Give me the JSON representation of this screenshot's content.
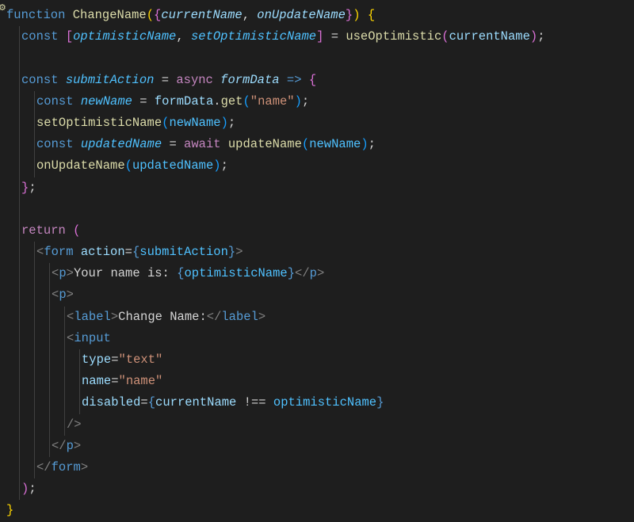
{
  "editor": {
    "language": "javascript-react",
    "theme": "dark-plus",
    "font": "Menlo",
    "lines": [
      {
        "n": 1,
        "indent": 0,
        "tokens": [
          {
            "t": "function ",
            "c": "kw"
          },
          {
            "t": "ChangeName",
            "c": "fn"
          },
          {
            "t": "(",
            "c": "brc1"
          },
          {
            "t": "{",
            "c": "brc2"
          },
          {
            "t": "currentName",
            "c": "var"
          },
          {
            "t": ", ",
            "c": "punc"
          },
          {
            "t": "onUpdateName",
            "c": "var"
          },
          {
            "t": "}",
            "c": "brc2"
          },
          {
            "t": ")",
            "c": "brc1"
          },
          {
            "t": " ",
            "c": "punc"
          },
          {
            "t": "{",
            "c": "brc1"
          }
        ]
      },
      {
        "n": 2,
        "indent": 1,
        "g": [
          1
        ],
        "tokens": [
          {
            "t": "const ",
            "c": "str"
          },
          {
            "t": "[",
            "c": "brc2"
          },
          {
            "t": "optimisticName",
            "c": "cnst"
          },
          {
            "t": ", ",
            "c": "punc"
          },
          {
            "t": "setOptimisticName",
            "c": "cnst"
          },
          {
            "t": "]",
            "c": "brc2"
          },
          {
            "t": " = ",
            "c": "op"
          },
          {
            "t": "useOptimistic",
            "c": "fn"
          },
          {
            "t": "(",
            "c": "brc2"
          },
          {
            "t": "currentName",
            "c": "varn"
          },
          {
            "t": ")",
            "c": "brc2"
          },
          {
            "t": ";",
            "c": "punc"
          }
        ]
      },
      {
        "n": 3,
        "indent": 0,
        "g": [
          1
        ],
        "tokens": []
      },
      {
        "n": 4,
        "indent": 1,
        "g": [
          1
        ],
        "tokens": [
          {
            "t": "const ",
            "c": "str"
          },
          {
            "t": "submitAction",
            "c": "cnst"
          },
          {
            "t": " = ",
            "c": "op"
          },
          {
            "t": "async ",
            "c": "ctrl"
          },
          {
            "t": "formData",
            "c": "var"
          },
          {
            "t": " ",
            "c": "punc"
          },
          {
            "t": "=>",
            "c": "str"
          },
          {
            "t": " ",
            "c": "punc"
          },
          {
            "t": "{",
            "c": "brc2"
          }
        ]
      },
      {
        "n": 5,
        "indent": 2,
        "g": [
          1,
          2
        ],
        "tokens": [
          {
            "t": "const ",
            "c": "str"
          },
          {
            "t": "newName",
            "c": "cnst"
          },
          {
            "t": " = ",
            "c": "op"
          },
          {
            "t": "formData",
            "c": "varn"
          },
          {
            "t": ".",
            "c": "punc"
          },
          {
            "t": "get",
            "c": "fn"
          },
          {
            "t": "(",
            "c": "brc3"
          },
          {
            "t": "\"name\"",
            "c": "strl"
          },
          {
            "t": ")",
            "c": "brc3"
          },
          {
            "t": ";",
            "c": "punc"
          }
        ]
      },
      {
        "n": 6,
        "indent": 2,
        "g": [
          1,
          2
        ],
        "tokens": [
          {
            "t": "setOptimisticName",
            "c": "fn"
          },
          {
            "t": "(",
            "c": "brc3"
          },
          {
            "t": "newName",
            "c": "cnstn"
          },
          {
            "t": ")",
            "c": "brc3"
          },
          {
            "t": ";",
            "c": "punc"
          }
        ]
      },
      {
        "n": 7,
        "indent": 2,
        "g": [
          1,
          2
        ],
        "tokens": [
          {
            "t": "const ",
            "c": "str"
          },
          {
            "t": "updatedName",
            "c": "cnst"
          },
          {
            "t": " = ",
            "c": "op"
          },
          {
            "t": "await ",
            "c": "ctrl"
          },
          {
            "t": "updateName",
            "c": "fn"
          },
          {
            "t": "(",
            "c": "brc3"
          },
          {
            "t": "newName",
            "c": "cnstn"
          },
          {
            "t": ")",
            "c": "brc3"
          },
          {
            "t": ";",
            "c": "punc"
          }
        ]
      },
      {
        "n": 8,
        "indent": 2,
        "g": [
          1,
          2
        ],
        "tokens": [
          {
            "t": "onUpdateName",
            "c": "fn"
          },
          {
            "t": "(",
            "c": "brc3"
          },
          {
            "t": "updatedName",
            "c": "cnstn"
          },
          {
            "t": ")",
            "c": "brc3"
          },
          {
            "t": ";",
            "c": "punc"
          }
        ]
      },
      {
        "n": 9,
        "indent": 1,
        "g": [
          1
        ],
        "tokens": [
          {
            "t": "}",
            "c": "brc2"
          },
          {
            "t": ";",
            "c": "punc"
          }
        ]
      },
      {
        "n": 10,
        "indent": 0,
        "g": [
          1
        ],
        "tokens": []
      },
      {
        "n": 11,
        "indent": 1,
        "g": [
          1
        ],
        "tokens": [
          {
            "t": "return ",
            "c": "ctrl"
          },
          {
            "t": "(",
            "c": "brc2"
          }
        ]
      },
      {
        "n": 12,
        "indent": 2,
        "g": [
          1,
          2
        ],
        "tokens": [
          {
            "t": "<",
            "c": "tag"
          },
          {
            "t": "form",
            "c": "tagn"
          },
          {
            "t": " ",
            "c": "punc"
          },
          {
            "t": "action",
            "c": "attr"
          },
          {
            "t": "=",
            "c": "op"
          },
          {
            "t": "{",
            "c": "str"
          },
          {
            "t": "submitAction",
            "c": "cnstn"
          },
          {
            "t": "}",
            "c": "str"
          },
          {
            "t": ">",
            "c": "tag"
          }
        ]
      },
      {
        "n": 13,
        "indent": 3,
        "g": [
          1,
          2,
          3
        ],
        "tokens": [
          {
            "t": "<",
            "c": "tag"
          },
          {
            "t": "p",
            "c": "tagn"
          },
          {
            "t": ">",
            "c": "tag"
          },
          {
            "t": "Your name is: ",
            "c": "txt"
          },
          {
            "t": "{",
            "c": "str"
          },
          {
            "t": "optimisticName",
            "c": "cnstn"
          },
          {
            "t": "}",
            "c": "str"
          },
          {
            "t": "</",
            "c": "tag"
          },
          {
            "t": "p",
            "c": "tagn"
          },
          {
            "t": ">",
            "c": "tag"
          }
        ]
      },
      {
        "n": 14,
        "indent": 3,
        "g": [
          1,
          2,
          3
        ],
        "tokens": [
          {
            "t": "<",
            "c": "tag"
          },
          {
            "t": "p",
            "c": "tagn"
          },
          {
            "t": ">",
            "c": "tag"
          }
        ]
      },
      {
        "n": 15,
        "indent": 4,
        "g": [
          1,
          2,
          3,
          4
        ],
        "tokens": [
          {
            "t": "<",
            "c": "tag"
          },
          {
            "t": "label",
            "c": "tagn"
          },
          {
            "t": ">",
            "c": "tag"
          },
          {
            "t": "Change Name:",
            "c": "txt"
          },
          {
            "t": "</",
            "c": "tag"
          },
          {
            "t": "label",
            "c": "tagn"
          },
          {
            "t": ">",
            "c": "tag"
          }
        ]
      },
      {
        "n": 16,
        "indent": 4,
        "g": [
          1,
          2,
          3,
          4
        ],
        "tokens": [
          {
            "t": "<",
            "c": "tag"
          },
          {
            "t": "input",
            "c": "tagn"
          }
        ]
      },
      {
        "n": 17,
        "indent": 5,
        "g": [
          1,
          2,
          3,
          4,
          5
        ],
        "tokens": [
          {
            "t": "type",
            "c": "attr"
          },
          {
            "t": "=",
            "c": "op"
          },
          {
            "t": "\"text\"",
            "c": "strl"
          }
        ]
      },
      {
        "n": 18,
        "indent": 5,
        "g": [
          1,
          2,
          3,
          4,
          5
        ],
        "tokens": [
          {
            "t": "name",
            "c": "attr"
          },
          {
            "t": "=",
            "c": "op"
          },
          {
            "t": "\"name\"",
            "c": "strl"
          }
        ]
      },
      {
        "n": 19,
        "indent": 5,
        "g": [
          1,
          2,
          3,
          4,
          5
        ],
        "tokens": [
          {
            "t": "disabled",
            "c": "attr"
          },
          {
            "t": "=",
            "c": "op"
          },
          {
            "t": "{",
            "c": "str"
          },
          {
            "t": "currentName",
            "c": "varn"
          },
          {
            "t": " !== ",
            "c": "op"
          },
          {
            "t": "optimisticName",
            "c": "cnstn"
          },
          {
            "t": "}",
            "c": "str"
          }
        ]
      },
      {
        "n": 20,
        "indent": 4,
        "g": [
          1,
          2,
          3,
          4
        ],
        "tokens": [
          {
            "t": "/>",
            "c": "tag"
          }
        ]
      },
      {
        "n": 21,
        "indent": 3,
        "g": [
          1,
          2,
          3
        ],
        "tokens": [
          {
            "t": "</",
            "c": "tag"
          },
          {
            "t": "p",
            "c": "tagn"
          },
          {
            "t": ">",
            "c": "tag"
          }
        ]
      },
      {
        "n": 22,
        "indent": 2,
        "g": [
          1,
          2
        ],
        "tokens": [
          {
            "t": "</",
            "c": "tag"
          },
          {
            "t": "form",
            "c": "tagn"
          },
          {
            "t": ">",
            "c": "tag"
          }
        ]
      },
      {
        "n": 23,
        "indent": 1,
        "g": [
          1
        ],
        "tokens": [
          {
            "t": ")",
            "c": "brc2"
          },
          {
            "t": ";",
            "c": "punc"
          }
        ]
      },
      {
        "n": 24,
        "indent": 0,
        "tokens": [
          {
            "t": "}",
            "c": "brc1"
          }
        ]
      }
    ]
  },
  "activity_fragment": "⚙"
}
